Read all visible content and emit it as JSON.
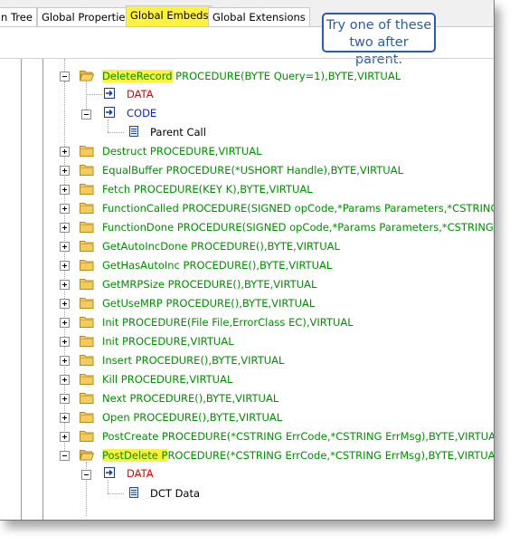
{
  "tabs": [
    {
      "label": "n Tree",
      "active": false
    },
    {
      "label": "Global Properties",
      "active": false
    },
    {
      "label": "Global Embeds",
      "active": true
    },
    {
      "label": "Global Extensions",
      "active": false
    }
  ],
  "callout": {
    "line1": "Try one of these",
    "line2": "two after parent."
  },
  "tree": {
    "delete_record": {
      "name": "DeleteRecord",
      "sig": " PROCEDURE(BYTE Query=1),BYTE,VIRTUAL"
    },
    "data_label": "DATA",
    "code_label": "CODE",
    "parent_call": "Parent Call",
    "procedures": [
      "Destruct PROCEDURE,VIRTUAL",
      "EqualBuffer PROCEDURE(*USHORT Handle),BYTE,VIRTUAL",
      "Fetch PROCEDURE(KEY K),BYTE,VIRTUAL",
      "FunctionCalled PROCEDURE(SIGNED opCode,*Params Parameters,*CSTRING ErrC",
      "FunctionDone PROCEDURE(SIGNED opCode,*Params Parameters,*CSTRING ErrCo",
      "GetAutoIncDone PROCEDURE(),BYTE,VIRTUAL",
      "GetHasAutoInc PROCEDURE(),BYTE,VIRTUAL",
      "GetMRPSize PROCEDURE(),BYTE,VIRTUAL",
      "GetUseMRP PROCEDURE(),BYTE,VIRTUAL",
      "Init PROCEDURE(File File,ErrorClass EC),VIRTUAL",
      "Init PROCEDURE,VIRTUAL",
      "Insert PROCEDURE(),BYTE,VIRTUAL",
      "Kill PROCEDURE,VIRTUAL",
      "Next PROCEDURE(),BYTE,VIRTUAL",
      "Open PROCEDURE(),BYTE,VIRTUAL",
      "PostCreate PROCEDURE(*CSTRING ErrCode,*CSTRING ErrMsg),BYTE,VIRTUAL"
    ],
    "post_delete": {
      "name": "PostDelete P",
      "sig": "ROCEDURE(*CSTRING ErrCode,*CSTRING ErrMsg),BYTE,VIRTUAL"
    },
    "post_delete_data": "DATA",
    "dct_data": "DCT Data"
  },
  "colors": {
    "highlight": "#fff23f",
    "procedure_green": "#008f00",
    "data_red": "#e00000",
    "code_blue": "#0a1ee0",
    "callout_border": "#2a5ab8"
  }
}
